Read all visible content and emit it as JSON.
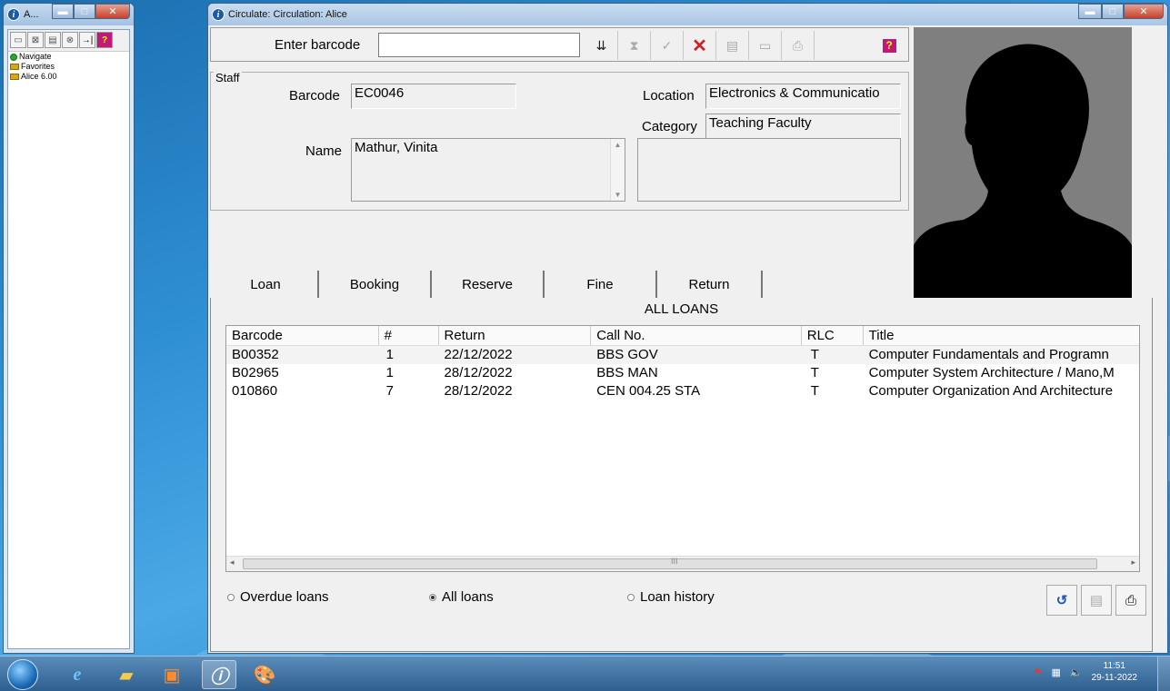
{
  "nav_window": {
    "title": "A...",
    "tree": [
      {
        "label": "Navigate",
        "icon": "green-dot-icon"
      },
      {
        "label": "Favorites",
        "icon": "folder-icon"
      },
      {
        "label": "Alice 6.00",
        "icon": "folder-icon"
      }
    ]
  },
  "main_window": {
    "title": "Circulate: Circulation: Alice"
  },
  "barcode": {
    "label": "Enter barcode",
    "value": ""
  },
  "toolbar": [
    "enter-icon",
    "filter-icon",
    "check-icon",
    "delete-icon",
    "open-icon",
    "new-icon",
    "print-icon",
    "help-icon"
  ],
  "staff": {
    "legend": "Staff",
    "barcode_label": "Barcode",
    "barcode_value": "EC0046",
    "location_label": "Location",
    "location_value": "Electronics & Communicatio",
    "category_label": "Category",
    "category_value": "Teaching Faculty",
    "name_label": "Name",
    "name_value": "Mathur, Vinita"
  },
  "tabs": [
    "Loan",
    "Booking",
    "Reserve",
    "Fine",
    "Return"
  ],
  "loans": {
    "caption": "ALL LOANS",
    "columns": [
      "Barcode",
      "#",
      "Return",
      "Call No.",
      "RLC",
      "Title"
    ],
    "rows": [
      [
        "B00352",
        "1",
        "22/12/2022",
        "BBS GOV",
        "T",
        "Computer Fundamentals and Programn"
      ],
      [
        "B02965",
        "1",
        "28/12/2022",
        "BBS MAN",
        "T",
        "Computer System Architecture / Mano,M"
      ],
      [
        "010860",
        "7",
        "28/12/2022",
        "CEN 004.25 STA",
        "T",
        "Computer Organization And Architecture"
      ]
    ],
    "scroll_mid": "III"
  },
  "radios": {
    "overdue": "Overdue loans",
    "all": "All loans",
    "history": "Loan history",
    "selected": "all"
  },
  "taskbar": {
    "time": "11:51",
    "date": "29-11-2022"
  }
}
